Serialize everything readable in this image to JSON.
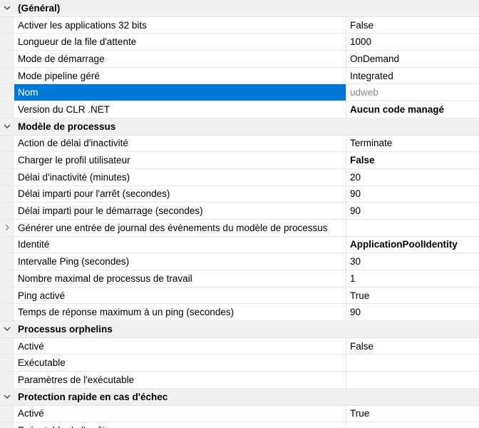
{
  "colors": {
    "selection": "#0078d7",
    "category_bg": "#f0f0f0",
    "readonly_value": "#8a8a8a"
  },
  "categories": [
    {
      "name": "(Général)",
      "expanded": true,
      "icon": "chevron-down-icon",
      "rows": [
        {
          "name": "Activer les applications 32 bits",
          "value": "False"
        },
        {
          "name": "Longueur de la file d'attente",
          "value": "1000"
        },
        {
          "name": "Mode de démarrage",
          "value": "OnDemand"
        },
        {
          "name": "Mode pipeline géré",
          "value": "Integrated"
        },
        {
          "name": "Nom",
          "value": "udweb",
          "selected": true,
          "readonly": true
        },
        {
          "name": "Version du CLR .NET",
          "value": "Aucun code managé",
          "bold": true
        }
      ]
    },
    {
      "name": "Modèle de processus",
      "expanded": true,
      "icon": "chevron-down-icon",
      "rows": [
        {
          "name": "Action de délai d'inactivité",
          "value": "Terminate"
        },
        {
          "name": "Charger le profil utilisateur",
          "value": "False",
          "bold": true
        },
        {
          "name": "Délai d'inactivité (minutes)",
          "value": "20"
        },
        {
          "name": "Délai imparti pour l'arrêt (secondes)",
          "value": "90"
        },
        {
          "name": "Délai imparti pour le démarrage (secondes)",
          "value": "90"
        },
        {
          "name": "Générer une entrée de journal des évènements du modèle de processus",
          "value": "",
          "expandable": true,
          "icon": "chevron-right-icon"
        },
        {
          "name": "Identité",
          "value": "ApplicationPoolIdentity",
          "bold": true
        },
        {
          "name": "Intervalle Ping (secondes)",
          "value": "30"
        },
        {
          "name": "Nombre maximal de processus de travail",
          "value": "1"
        },
        {
          "name": "Ping activé",
          "value": "True"
        },
        {
          "name": "Temps de réponse maximum à un ping (secondes)",
          "value": "90"
        }
      ]
    },
    {
      "name": "Processus orphelins",
      "expanded": true,
      "icon": "chevron-down-icon",
      "rows": [
        {
          "name": "Activé",
          "value": "False"
        },
        {
          "name": "Exécutable",
          "value": ""
        },
        {
          "name": "Paramètres de l'exécutable",
          "value": ""
        }
      ]
    },
    {
      "name": "Protection rapide en cas d'échec",
      "expanded": true,
      "icon": "chevron-down-icon",
      "rows": [
        {
          "name": "Activé",
          "value": "True"
        },
        {
          "name": "Exécutable de l'arrêt",
          "value": ""
        }
      ]
    }
  ]
}
